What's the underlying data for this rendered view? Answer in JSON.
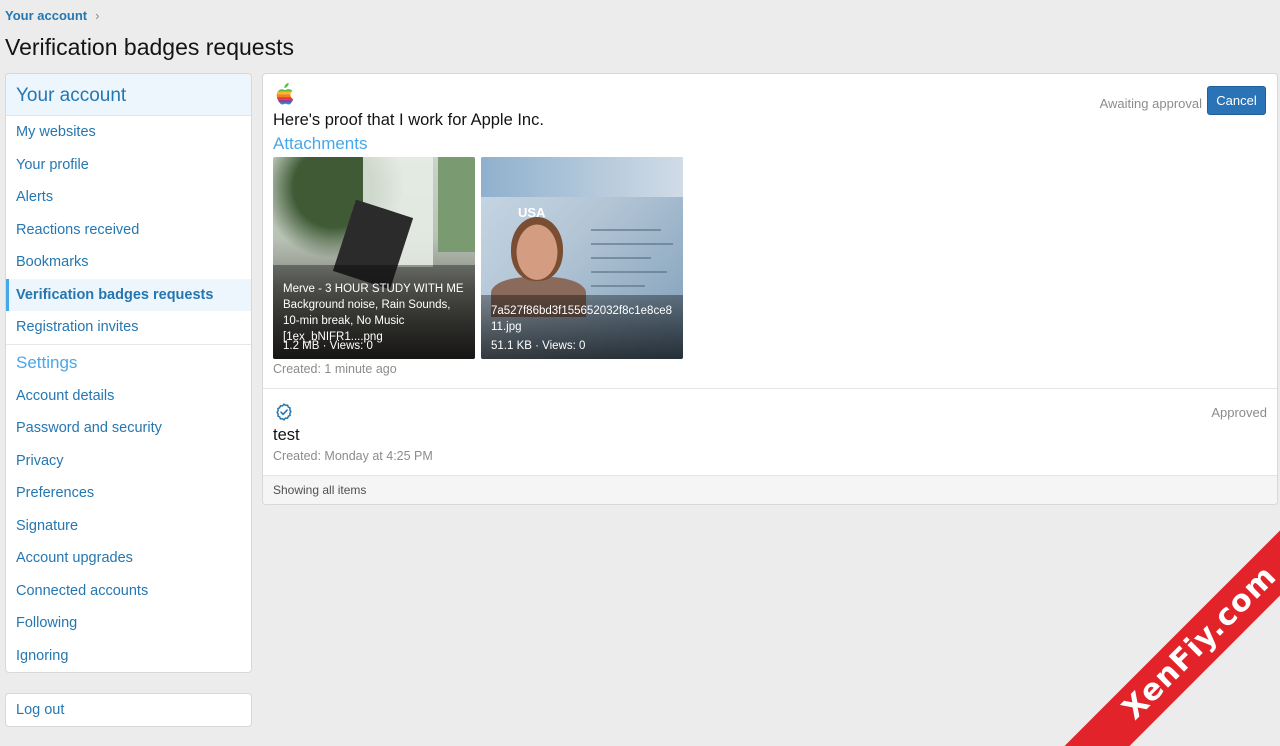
{
  "breadcrumb": {
    "label": "Your account",
    "separator": "›"
  },
  "page_title": "Verification badges requests",
  "sidebar": {
    "header": "Your account",
    "items": [
      {
        "label": "My websites"
      },
      {
        "label": "Your profile"
      },
      {
        "label": "Alerts"
      },
      {
        "label": "Reactions received"
      },
      {
        "label": "Bookmarks"
      },
      {
        "label": "Verification badges requests",
        "active": true
      },
      {
        "label": "Registration invites"
      }
    ],
    "settings_header": "Settings",
    "settings_items": [
      {
        "label": "Account details"
      },
      {
        "label": "Password and security"
      },
      {
        "label": "Privacy"
      },
      {
        "label": "Preferences"
      },
      {
        "label": "Signature"
      },
      {
        "label": "Account upgrades"
      },
      {
        "label": "Connected accounts"
      },
      {
        "label": "Following"
      },
      {
        "label": "Ignoring"
      }
    ],
    "logout": "Log out"
  },
  "requests": [
    {
      "icon": "apple-logo-icon",
      "status": "Awaiting approval",
      "cancel_label": "Cancel",
      "message": "Here's proof that I work for Apple Inc.",
      "attachments_title": "Attachments",
      "attachments": [
        {
          "name": "Merve - 3 HOUR STUDY WITH ME Background noise, Rain Sounds, 10-min break, No Music [1ex_bNIFR1....png",
          "meta": "1.2 MB · Views: 0"
        },
        {
          "name": "7a527f86bd3f155652032f8c1e8ce811.jpg",
          "meta": "51.1 KB · Views: 0",
          "image_text": "USA"
        }
      ],
      "created": "Created: 1 minute ago"
    },
    {
      "icon": "verified-check-icon",
      "status": "Approved",
      "message": "test",
      "created": "Created: Monday at 4:25 PM"
    }
  ],
  "footer_text": "Showing all items",
  "watermark": "XenFiy.com",
  "colors": {
    "link": "#2577b1",
    "accent": "#47a7eb",
    "button": "#2b73b7",
    "ribbon": "#e2232a"
  }
}
